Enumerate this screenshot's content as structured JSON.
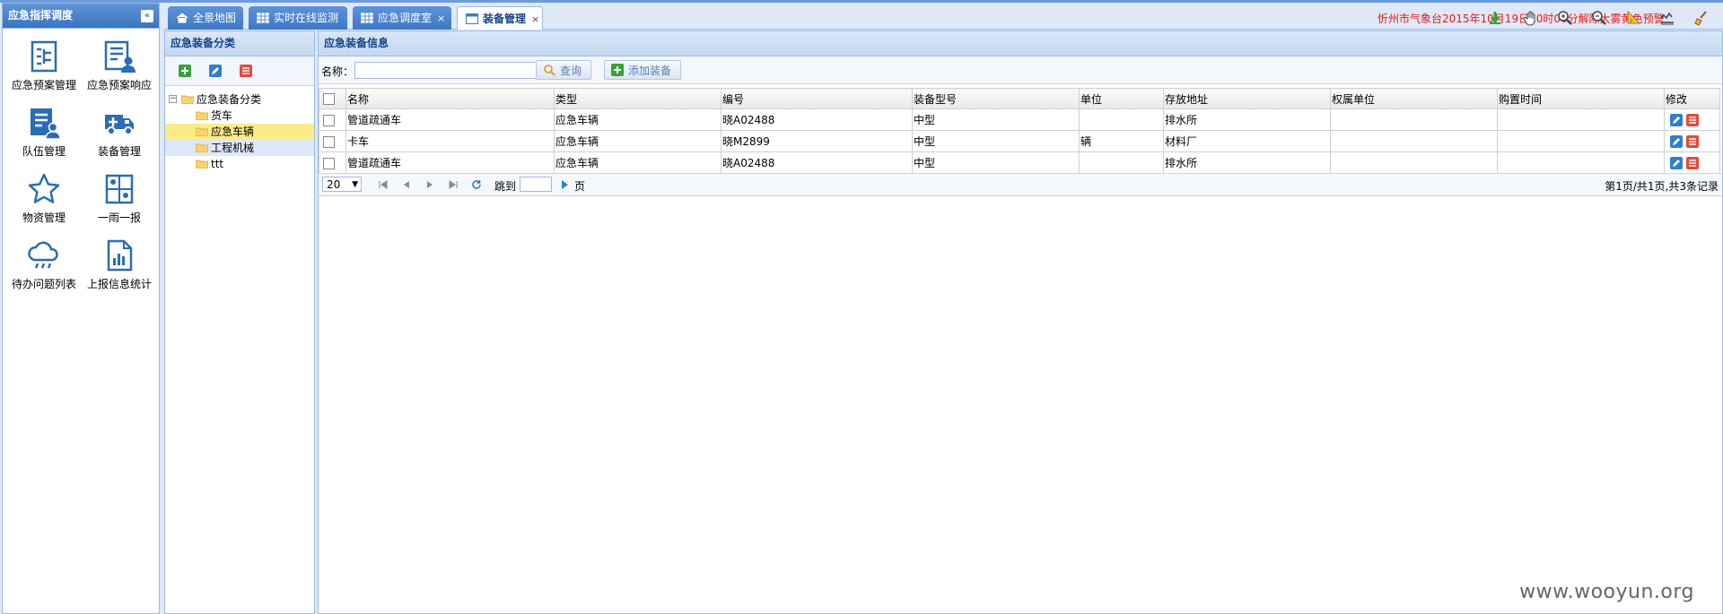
{
  "nav_panel": {
    "title": "应急指挥调度",
    "items": [
      {
        "label": "应急预案管理",
        "icon": "plan-doc-icon"
      },
      {
        "label": "应急预案响应",
        "icon": "plan-response-icon"
      },
      {
        "label": "队伍管理",
        "icon": "team-icon"
      },
      {
        "label": "装备管理",
        "icon": "truck-icon"
      },
      {
        "label": "物资管理",
        "icon": "star-icon"
      },
      {
        "label": "一雨一报",
        "icon": "map-pin-icon"
      },
      {
        "label": "待办问题列表",
        "icon": "rain-cloud-icon"
      },
      {
        "label": "上报信息统计",
        "icon": "report-chart-icon"
      }
    ]
  },
  "tabs": [
    {
      "label": "全景地图"
    },
    {
      "label": "实时在线监测"
    },
    {
      "label": "应急调度室",
      "close": "×"
    },
    {
      "label": "装备管理",
      "close": "×",
      "active": true
    }
  ],
  "alert_text": "忻州市气象台2015年10月19日10时00分解除大雾黄色预警",
  "tree_panel": {
    "title": "应急装备分类",
    "root": "应急装备分类",
    "children": [
      "货车",
      "应急车辆",
      "工程机械",
      "ttt"
    ],
    "expander": "−"
  },
  "main_panel": {
    "title": "应急装备信息",
    "search_label": "名称：",
    "search_value": "",
    "query_button": "查询",
    "add_button": "添加装备"
  },
  "table": {
    "columns": [
      "名称",
      "类型",
      "编号",
      "装备型号",
      "单位",
      "存放地址",
      "权属单位",
      "购置时间",
      "修改"
    ],
    "rows": [
      [
        "管道疏通车",
        "应急车辆",
        "晓A02488",
        "中型",
        "",
        "排水所",
        "",
        ""
      ],
      [
        "卡车",
        "应急车辆",
        "晓M2899",
        "中型",
        "辆",
        "材料厂",
        "",
        ""
      ],
      [
        "管道疏通车",
        "应急车辆",
        "晓A02488",
        "中型",
        "",
        "排水所",
        "",
        ""
      ]
    ]
  },
  "pager": {
    "page_size": "20",
    "jump_label": "跳到",
    "page_label": "页",
    "page_value": "",
    "info": "第1页/共1页,共3条记录"
  },
  "watermark": "www.wooyun.org",
  "colors": {
    "accent": "#3f78c4",
    "alert": "#e41b1b",
    "selected": "#fbec88"
  }
}
